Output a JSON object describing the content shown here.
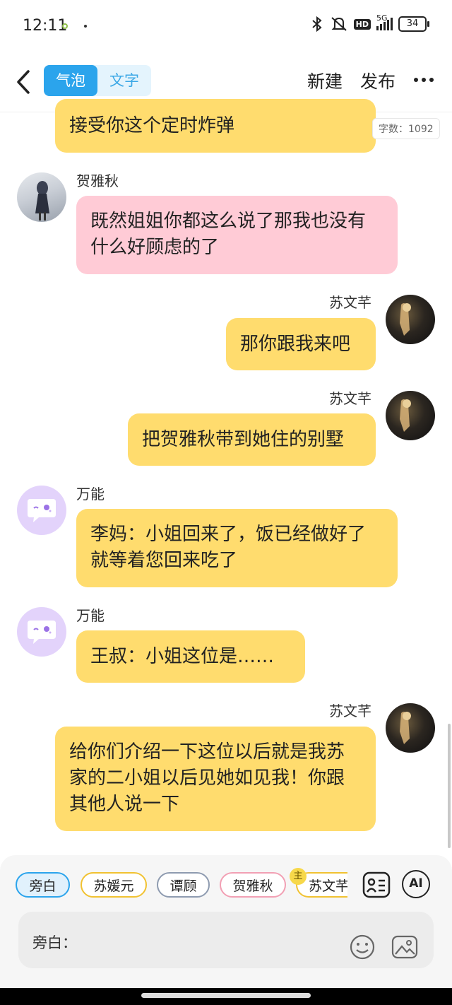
{
  "status_bar": {
    "time": "12:11",
    "network": "5G",
    "hd": "HD",
    "battery": "34"
  },
  "header": {
    "tabs": [
      {
        "label": "气泡",
        "active": true
      },
      {
        "label": "文字",
        "active": false
      }
    ],
    "new_label": "新建",
    "publish_label": "发布"
  },
  "word_count": "字数：1092",
  "messages": [
    {
      "speaker": "",
      "text": "接受你这个定时炸弹",
      "side": "left",
      "color": "#ffdc6e"
    },
    {
      "speaker": "贺雅秋",
      "text": "既然姐姐你都这么说了那我也没有什么好顾虑的了",
      "side": "left",
      "color": "#ffcbd6"
    },
    {
      "speaker": "苏文芊",
      "text": "那你跟我来吧",
      "side": "right",
      "color": "#ffdc6e"
    },
    {
      "speaker": "苏文芊",
      "text": "把贺雅秋带到她住的别墅",
      "side": "right",
      "color": "#ffdc6e"
    },
    {
      "speaker": "万能",
      "text": "李妈：小姐回来了，饭已经做好了就等着您回来吃了",
      "side": "left",
      "color": "#ffdc6e"
    },
    {
      "speaker": "万能",
      "text": "王叔：小姐这位是……",
      "side": "left",
      "color": "#ffdc6e"
    },
    {
      "speaker": "苏文芊",
      "text": "给你们介绍一下这位以后就是我苏家的二小姐以后见她如见我！你跟其他人说一下",
      "side": "right",
      "color": "#ffdc6e"
    }
  ],
  "characters": [
    {
      "label": "旁白",
      "color": "#2ba4ec",
      "selected": true
    },
    {
      "label": "苏媛元",
      "color": "#f1c232"
    },
    {
      "label": "谭顾",
      "color": "#8e9bb0"
    },
    {
      "label": "贺雅秋",
      "color": "#f2a0b4"
    },
    {
      "label": "苏文芊",
      "color": "#f1c232",
      "badge": "主"
    }
  ],
  "ai_label": "AI",
  "input": {
    "placeholder": "旁白："
  },
  "icons": {
    "back": "chevron-left-icon",
    "more": "more-dots-icon",
    "bluetooth": "bluetooth-icon",
    "mute": "bell-muted-icon",
    "signal": "signal-icon",
    "character_manage": "character-card-icon",
    "emoji": "emoji-icon",
    "image": "image-icon"
  }
}
